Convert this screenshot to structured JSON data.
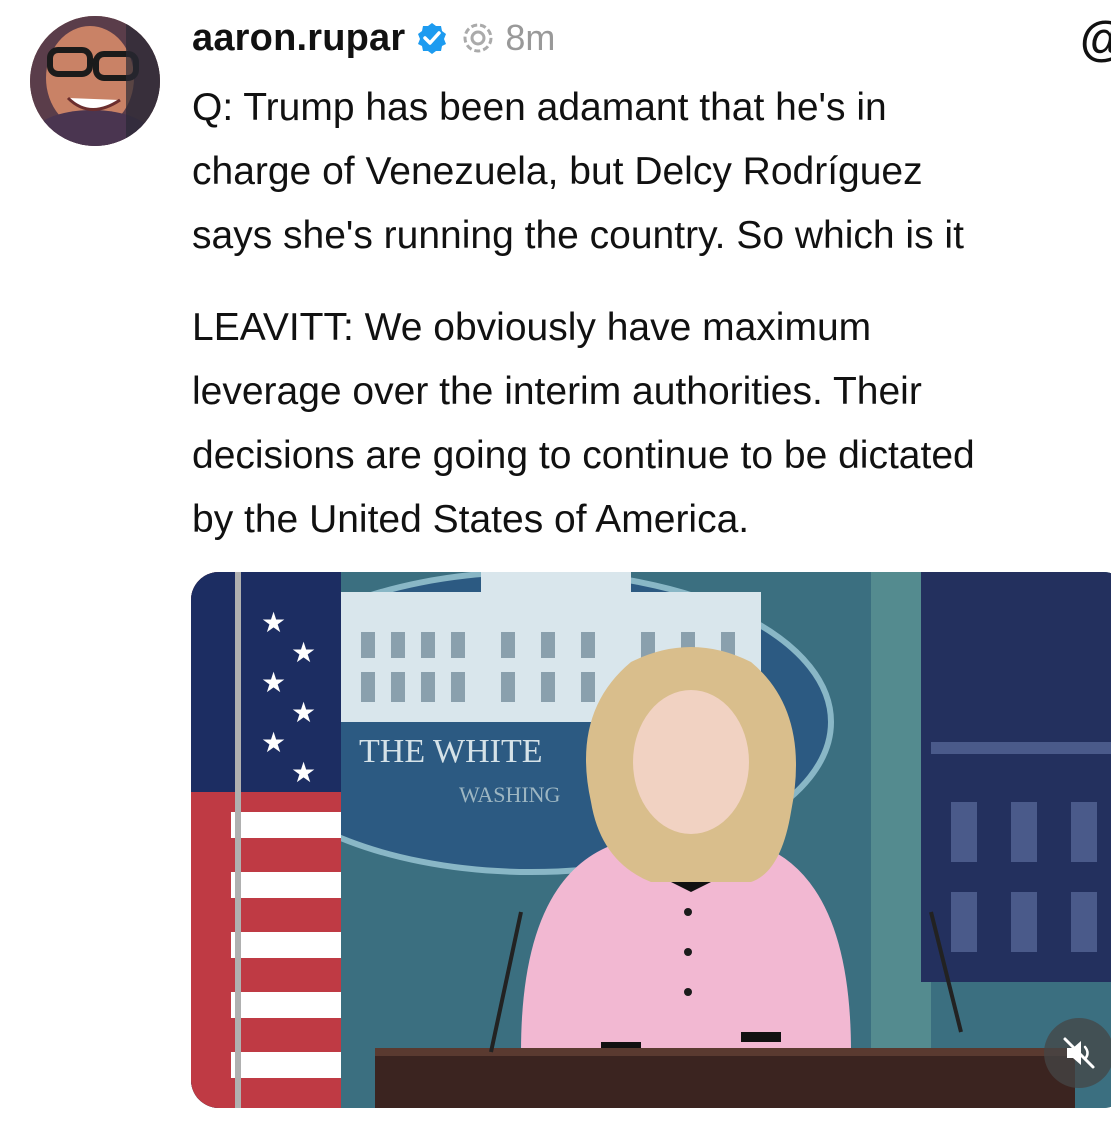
{
  "post": {
    "username": "aaron.rupar",
    "timestamp": "8m",
    "paragraphs": [
      [
        "Q: Trump has been adamant that he's in",
        "charge of Venezuela, but Delcy Rodríguez",
        "says she's running the country. So which is it"
      ],
      [
        "LEAVITT: We obviously have maximum",
        "leverage over the interim authorities. Their",
        "decisions are going to continue to be dictated",
        "by the United States of America."
      ]
    ]
  },
  "video": {
    "seal_text_1": "THE WHITE",
    "seal_text_2": "WASHING"
  },
  "icons": {
    "verified": "verified-badge-icon",
    "activity": "activity-ring-icon",
    "at": "threads-at-icon",
    "mute": "speaker-muted-icon"
  },
  "colors": {
    "verified": "#1d9bf0",
    "timestamp": "#999999"
  }
}
